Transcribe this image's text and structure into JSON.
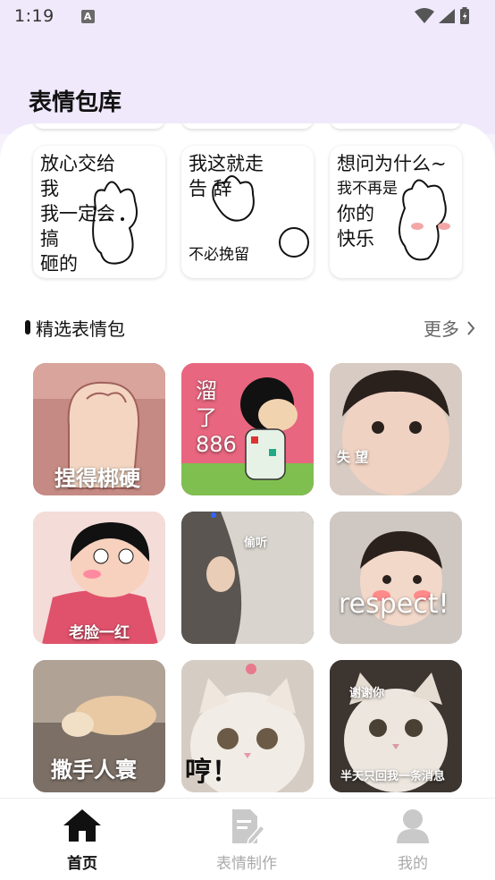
{
  "status_bar": {
    "time": "1:19",
    "notification_letter": "A"
  },
  "page_title": "表情包库",
  "top_stickers": [
    {
      "lines": [
        "放心交给我",
        "我一定会搞",
        "砸的",
        "！"
      ]
    },
    {
      "lines": [
        "我这就走",
        "告  辞",
        "",
        "不必挽留"
      ]
    },
    {
      "lines": [
        "想问为什么~",
        "我不再是",
        "你的",
        "快乐"
      ]
    }
  ],
  "section": {
    "title": "精选表情包",
    "more": "更多"
  },
  "tiles": [
    {
      "caption": "捏得梆硬",
      "colors": {
        "bg": "#c9928a"
      }
    },
    {
      "caption_lines": [
        "溜",
        "了",
        "886"
      ],
      "colors": {
        "bg": "#e8657f"
      }
    },
    {
      "caption": "失        望",
      "colors": {
        "bg": "#d7c9c2"
      }
    },
    {
      "caption": "老脸一红",
      "colors": {
        "bg": "#f3d9d6"
      }
    },
    {
      "caption": "偷听",
      "colors": {
        "bg": "#8e8a83"
      }
    },
    {
      "caption": "respect!",
      "colors": {
        "bg": "#c9c2bd"
      }
    },
    {
      "caption": "撒手人寰",
      "colors": {
        "bg": "#a8998c"
      }
    },
    {
      "caption": "哼！",
      "colors": {
        "bg": "#e7e2dc"
      }
    },
    {
      "caption_top": "谢谢你",
      "caption": "半天只回我一条消息",
      "colors": {
        "bg": "#3b342f"
      }
    }
  ],
  "nav": [
    {
      "label": "首页",
      "icon": "home-icon",
      "active": true
    },
    {
      "label": "表情制作",
      "icon": "edit-document-icon",
      "active": false
    },
    {
      "label": "我的",
      "icon": "user-icon",
      "active": false
    }
  ]
}
